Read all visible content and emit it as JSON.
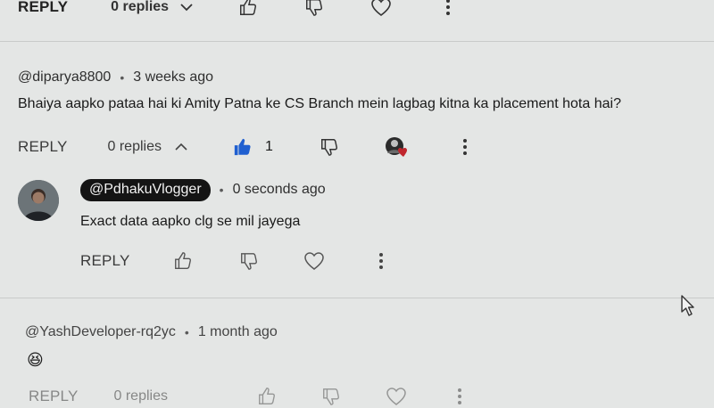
{
  "top_row": {
    "reply_label": "REPLY",
    "replies_label": "0 replies"
  },
  "comment1": {
    "handle": "@diparya8800",
    "time": "3 weeks ago",
    "text": "Bhaiya aapko pataa hai ki Amity Patna ke CS Branch mein lagbag kitna ka placement hota hai?",
    "reply_label": "REPLY",
    "replies_label": "0 replies",
    "like_count": "1",
    "accent_color": "#1f5fd0",
    "heart_color": "#c0262d"
  },
  "reply1": {
    "handle": "@PdhakuVlogger",
    "time": "0 seconds ago",
    "text": "Exact data aapko clg se mil jayega",
    "reply_label": "REPLY"
  },
  "comment2": {
    "handle": "@YashDeveloper-rq2yc",
    "time": "1 month ago",
    "emoji": "😆",
    "reply_label": "REPLY",
    "replies_label": "0 replies"
  }
}
